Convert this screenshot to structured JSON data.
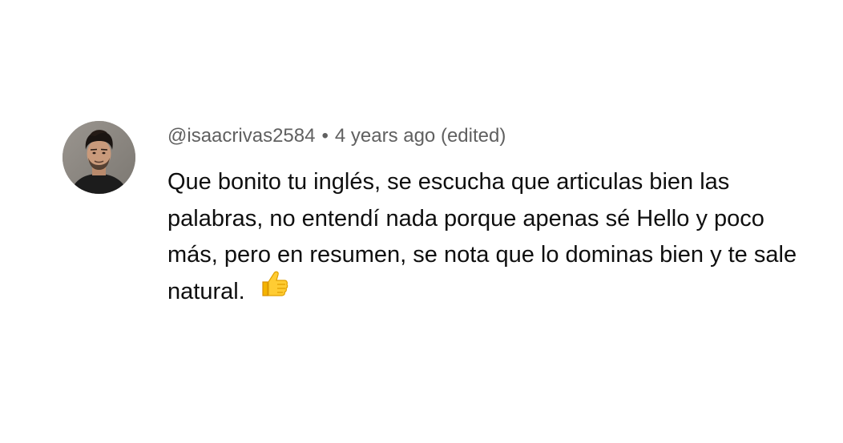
{
  "comment": {
    "author": "@isaacrivas2584",
    "separator": "•",
    "time": "4 years ago",
    "edited": "(edited)",
    "text": "Que bonito tu inglés, se escucha que articulas bien las palabras, no entendí nada porque apenas sé Hello y poco más, pero en resumen, se nota que lo dominas bien y te sale natural.",
    "emoji": "thumbs-up-icon"
  }
}
